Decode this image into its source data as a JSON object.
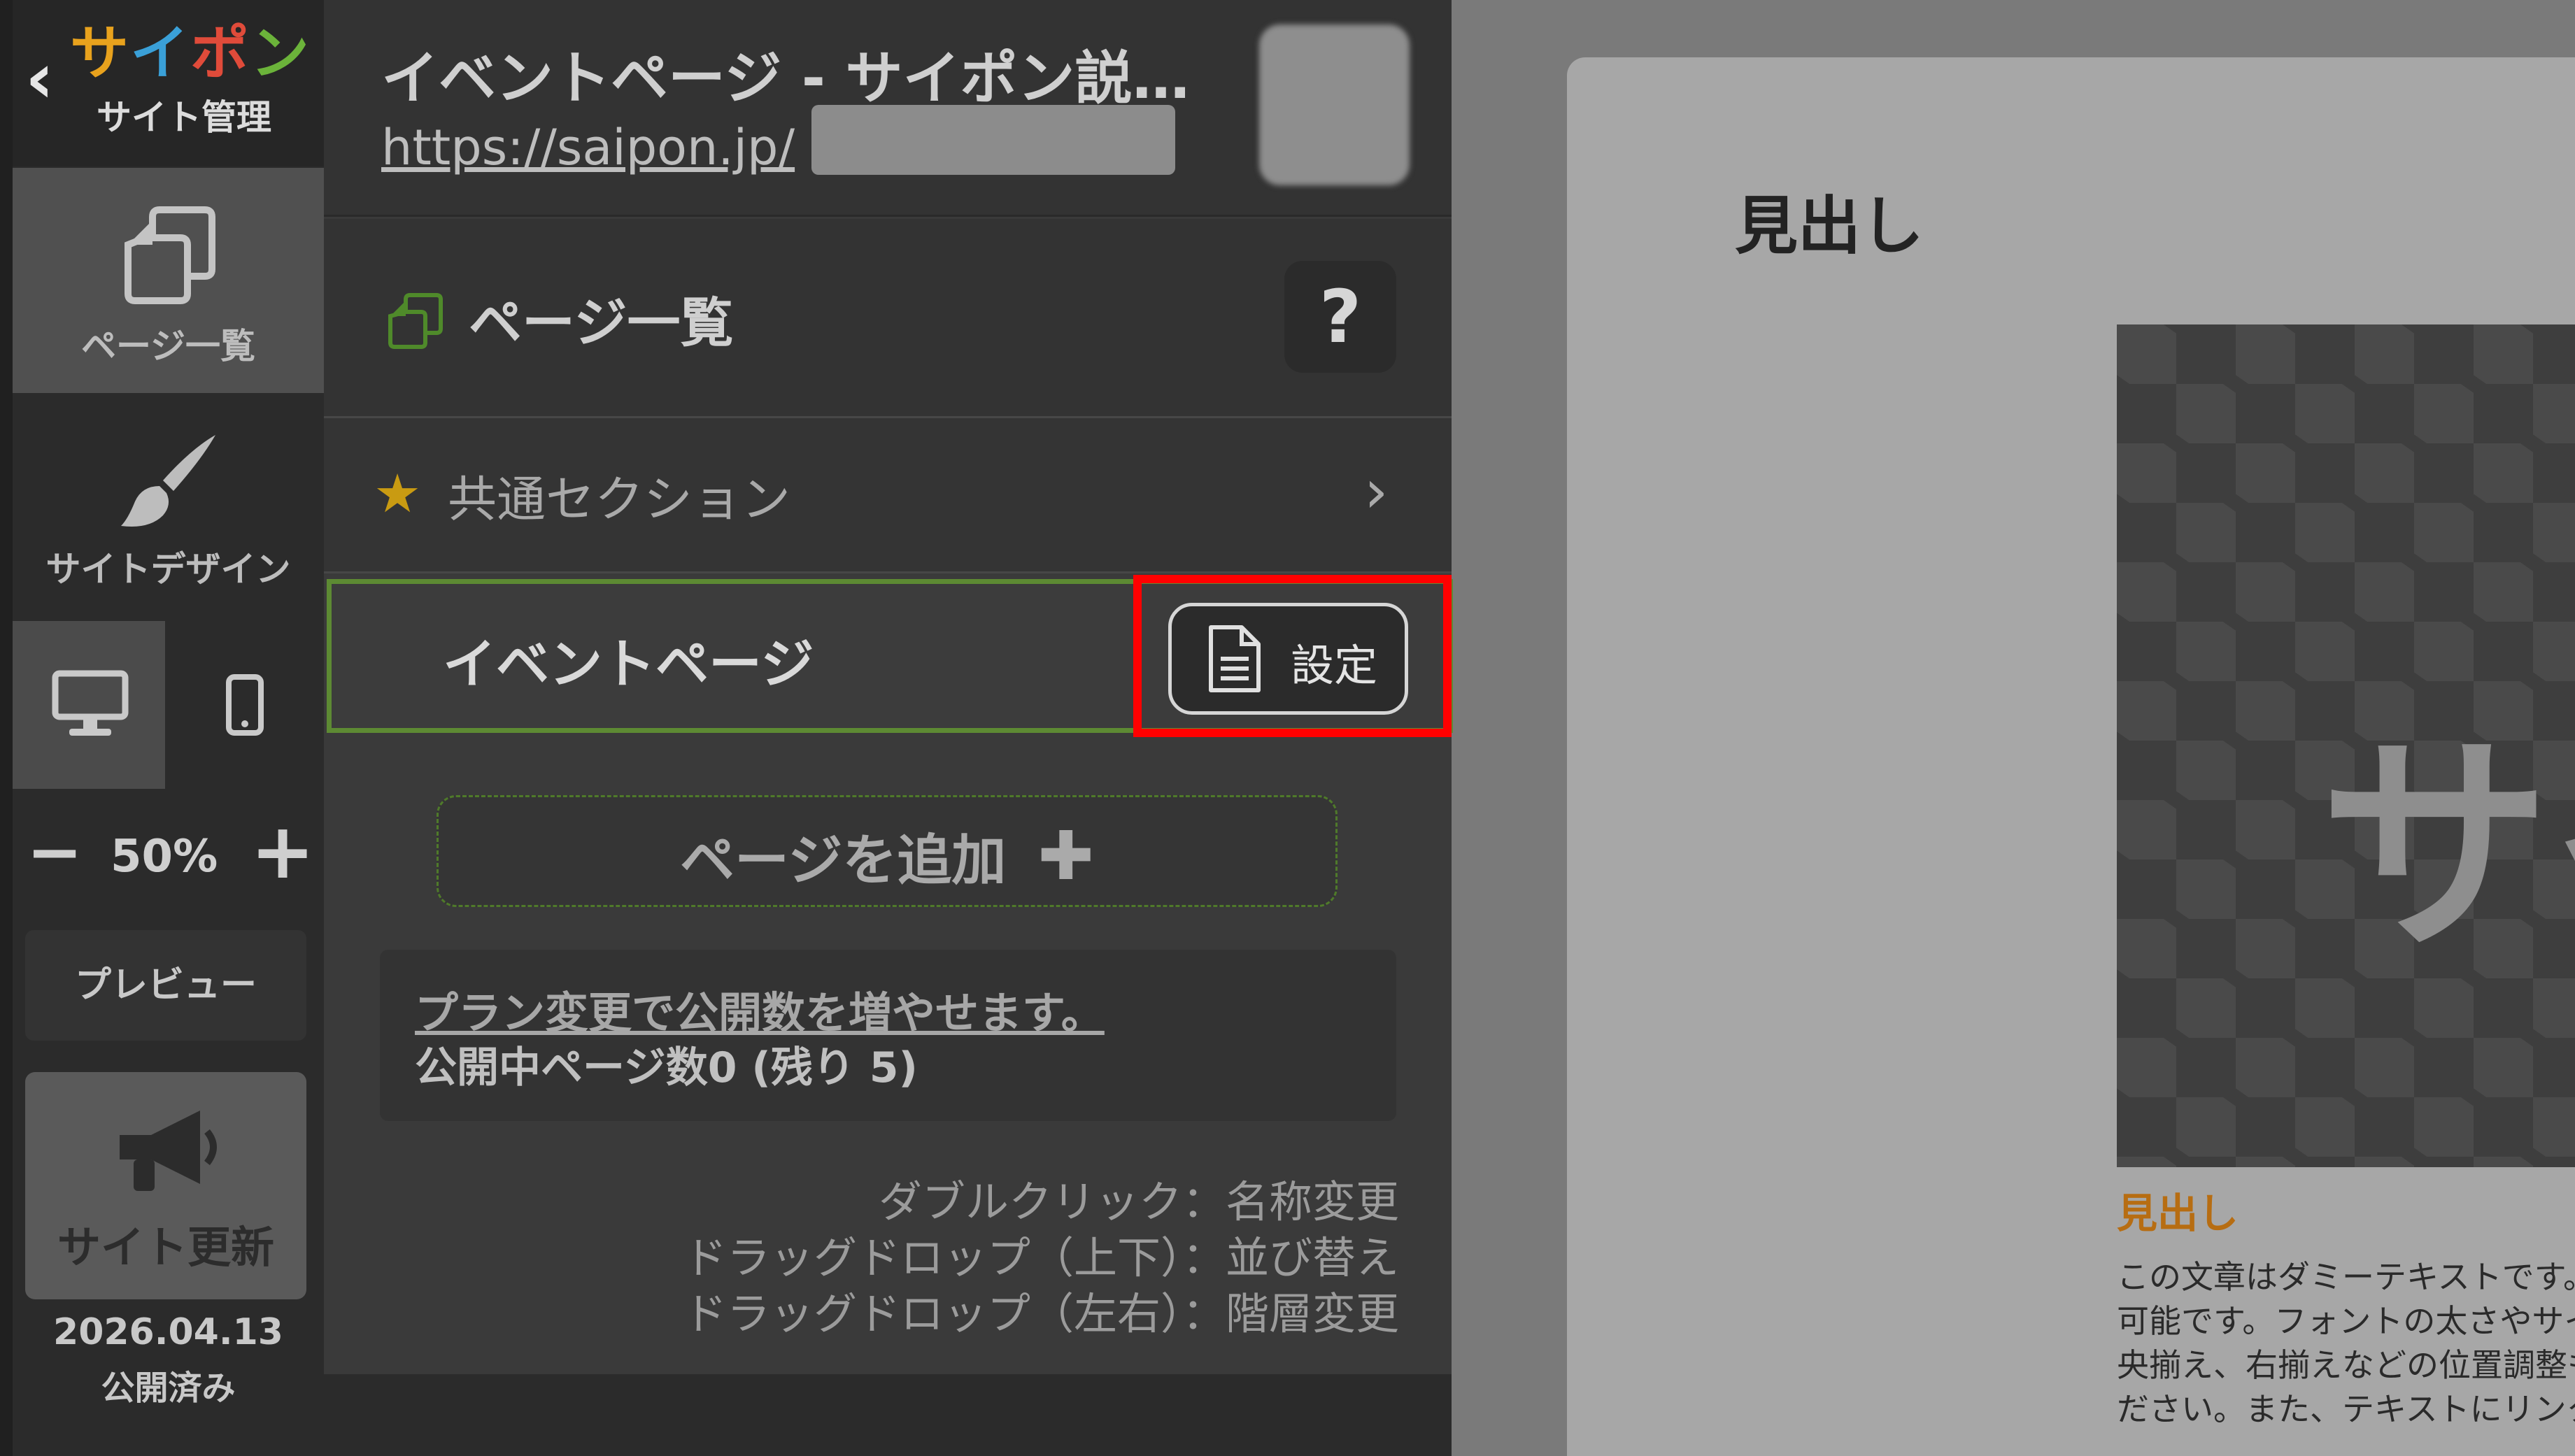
{
  "rail": {
    "logo": "サイポン",
    "logo_sub": "サイト管理",
    "pages_label": "ページ一覧",
    "design_label": "サイトデザイン",
    "zoom_value": "50%",
    "preview_label": "プレビュー",
    "update_label": "サイト更新",
    "publish_date": "2026.04.13",
    "publish_status": "公開済み"
  },
  "header": {
    "site_title": "イベントページ - サイポン説…",
    "site_url": "https://saipon.jp/"
  },
  "panel": {
    "title": "ページ一覧",
    "help": "?",
    "common_section": "共通セクション",
    "selected_page": "イベントページ",
    "settings_label": "設定",
    "add_page": "ページを追加",
    "plan_link": "プラン変更で公開数を増やせます。",
    "public_count": "公開中ページ数0 (残り 5)",
    "hints": [
      "ダブルクリック：名称変更",
      "ドラッグドロップ（上下）：並び替え",
      "ドラッグドロップ（左右）：階層変更"
    ]
  },
  "canvas": {
    "heading": "見出し",
    "image_text": "サイ",
    "subheading": "見出し",
    "body_lines": [
      "この文章はダミーテキストです。",
      "可能です。フォントの太さやサイ",
      "央揃え、右揃えなどの位置調整も",
      "ださい。また、テキストにリンク"
    ]
  },
  "colors": {
    "highlight": "#ff0000",
    "selected_border": "#5d8a33",
    "accent_orange": "#b76d12"
  }
}
